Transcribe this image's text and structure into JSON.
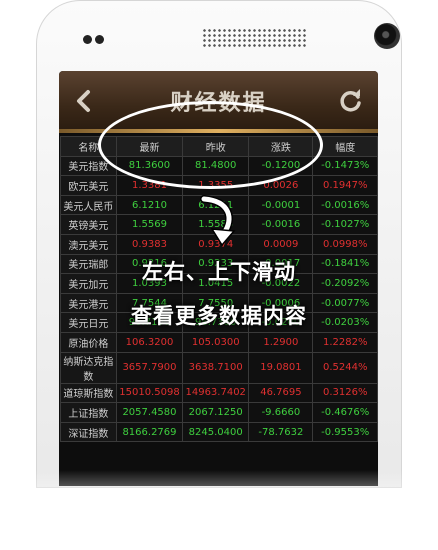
{
  "screen": {
    "title": "财经数据",
    "back_icon": "chevron-left-icon",
    "refresh_icon": "refresh-icon"
  },
  "table": {
    "headers": [
      "名称",
      "最新",
      "昨收",
      "涨跌",
      "幅度"
    ],
    "rows": [
      {
        "name": "美元指数",
        "latest": "81.3600",
        "prev": "81.4800",
        "change": "-0.1200",
        "pct": "-0.1473%",
        "color": "g"
      },
      {
        "name": "欧元美元",
        "latest": "1.3381",
        "prev": "1.3355",
        "change": "0.0026",
        "pct": "0.1947%",
        "color": "r"
      },
      {
        "name": "美元人民币",
        "latest": "6.1210",
        "prev": "6.1211",
        "change": "-0.0001",
        "pct": "-0.0016%",
        "color": "g"
      },
      {
        "name": "英镑美元",
        "latest": "1.5569",
        "prev": "1.5585",
        "change": "-0.0016",
        "pct": "-0.1027%",
        "color": "g"
      },
      {
        "name": "澳元美元",
        "latest": "0.9383",
        "prev": "0.9374",
        "change": "0.0009",
        "pct": "0.0998%",
        "color": "r"
      },
      {
        "name": "美元瑞郎",
        "latest": "0.9216",
        "prev": "0.9233",
        "change": "-0.0017",
        "pct": "-0.1841%",
        "color": "g"
      },
      {
        "name": "美元加元",
        "latest": "1.0393",
        "prev": "1.0415",
        "change": "-0.0022",
        "pct": "-0.2092%",
        "color": "g"
      },
      {
        "name": "美元港元",
        "latest": "7.7544",
        "prev": "7.7550",
        "change": "-0.0006",
        "pct": "-0.0077%",
        "color": "g"
      },
      {
        "name": "美元日元",
        "latest": "98.7100",
        "prev": "98.7300",
        "change": "-0.0200",
        "pct": "-0.0203%",
        "color": "g"
      },
      {
        "name": "原油价格",
        "latest": "106.3200",
        "prev": "105.0300",
        "change": "1.2900",
        "pct": "1.2282%",
        "color": "r"
      },
      {
        "name": "纳斯达克指数",
        "latest": "3657.7900",
        "prev": "3638.7100",
        "change": "19.0801",
        "pct": "0.5244%",
        "color": "r"
      },
      {
        "name": "道琼斯指数",
        "latest": "15010.5098",
        "prev": "14963.7402",
        "change": "46.7695",
        "pct": "0.3126%",
        "color": "r"
      },
      {
        "name": "上证指数",
        "latest": "2057.4580",
        "prev": "2067.1250",
        "change": "-9.6660",
        "pct": "-0.4676%",
        "color": "g"
      },
      {
        "name": "深证指数",
        "latest": "8166.2769",
        "prev": "8245.0400",
        "change": "-78.7632",
        "pct": "-0.9553%",
        "color": "g"
      }
    ]
  },
  "overlay": {
    "line1": "左右、上下滑动",
    "line2": "查看更多数据内容",
    "arrow_icon": "curved-arrow-down-icon"
  },
  "colors": {
    "up": "#e03030",
    "down": "#3fd03f",
    "title_bar": "#3a2818",
    "accent": "#e0b060"
  }
}
